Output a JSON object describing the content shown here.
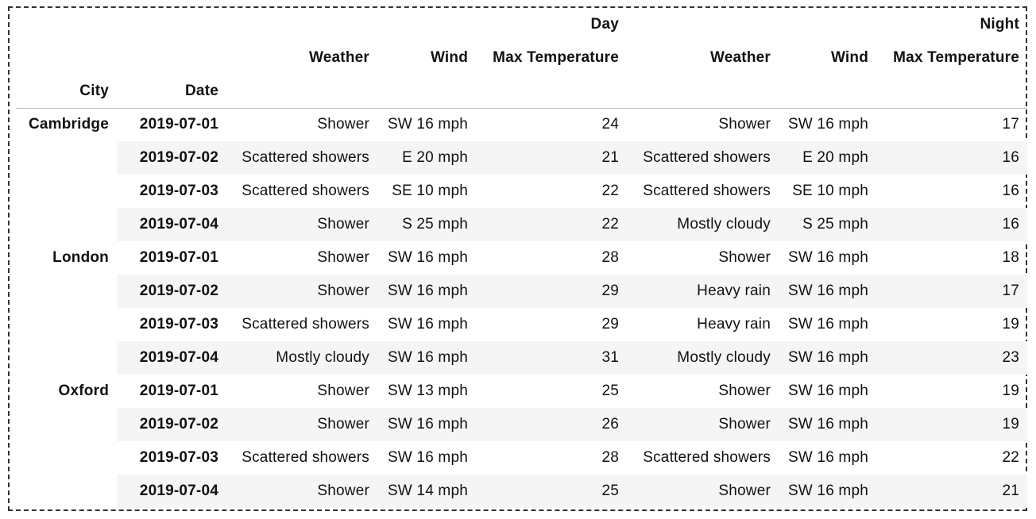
{
  "header": {
    "groups": {
      "day": "Day",
      "night": "Night"
    },
    "columns": {
      "day_weather": "Weather",
      "day_wind": "Wind",
      "day_max_temp": "Max Temperature",
      "night_weather": "Weather",
      "night_wind": "Wind",
      "night_max_temp": "Max Temperature"
    },
    "index": {
      "city": "City",
      "date": "Date"
    }
  },
  "rows": [
    {
      "city": "Cambridge",
      "date": "2019-07-01",
      "day_weather": "Shower",
      "day_wind": "SW 16 mph",
      "day_max": "24",
      "night_weather": "Shower",
      "night_wind": "SW 16 mph",
      "night_max": "17"
    },
    {
      "city": "",
      "date": "2019-07-02",
      "day_weather": "Scattered showers",
      "day_wind": "E 20 mph",
      "day_max": "21",
      "night_weather": "Scattered showers",
      "night_wind": "E 20 mph",
      "night_max": "16"
    },
    {
      "city": "",
      "date": "2019-07-03",
      "day_weather": "Scattered showers",
      "day_wind": "SE 10 mph",
      "day_max": "22",
      "night_weather": "Scattered showers",
      "night_wind": "SE 10 mph",
      "night_max": "16"
    },
    {
      "city": "",
      "date": "2019-07-04",
      "day_weather": "Shower",
      "day_wind": "S 25 mph",
      "day_max": "22",
      "night_weather": "Mostly cloudy",
      "night_wind": "S 25 mph",
      "night_max": "16"
    },
    {
      "city": "London",
      "date": "2019-07-01",
      "day_weather": "Shower",
      "day_wind": "SW 16 mph",
      "day_max": "28",
      "night_weather": "Shower",
      "night_wind": "SW 16 mph",
      "night_max": "18"
    },
    {
      "city": "",
      "date": "2019-07-02",
      "day_weather": "Shower",
      "day_wind": "SW 16 mph",
      "day_max": "29",
      "night_weather": "Heavy rain",
      "night_wind": "SW 16 mph",
      "night_max": "17"
    },
    {
      "city": "",
      "date": "2019-07-03",
      "day_weather": "Scattered showers",
      "day_wind": "SW 16 mph",
      "day_max": "29",
      "night_weather": "Heavy rain",
      "night_wind": "SW 16 mph",
      "night_max": "19"
    },
    {
      "city": "",
      "date": "2019-07-04",
      "day_weather": "Mostly cloudy",
      "day_wind": "SW 16 mph",
      "day_max": "31",
      "night_weather": "Mostly cloudy",
      "night_wind": "SW 16 mph",
      "night_max": "23"
    },
    {
      "city": "Oxford",
      "date": "2019-07-01",
      "day_weather": "Shower",
      "day_wind": "SW 13 mph",
      "day_max": "25",
      "night_weather": "Shower",
      "night_wind": "SW 16 mph",
      "night_max": "19"
    },
    {
      "city": "",
      "date": "2019-07-02",
      "day_weather": "Shower",
      "day_wind": "SW 16 mph",
      "day_max": "26",
      "night_weather": "Shower",
      "night_wind": "SW 16 mph",
      "night_max": "19"
    },
    {
      "city": "",
      "date": "2019-07-03",
      "day_weather": "Scattered showers",
      "day_wind": "SW 16 mph",
      "day_max": "28",
      "night_weather": "Scattered showers",
      "night_wind": "SW 16 mph",
      "night_max": "22"
    },
    {
      "city": "",
      "date": "2019-07-04",
      "day_weather": "Shower",
      "day_wind": "SW 14 mph",
      "day_max": "25",
      "night_weather": "Shower",
      "night_wind": "SW 16 mph",
      "night_max": "21"
    }
  ]
}
